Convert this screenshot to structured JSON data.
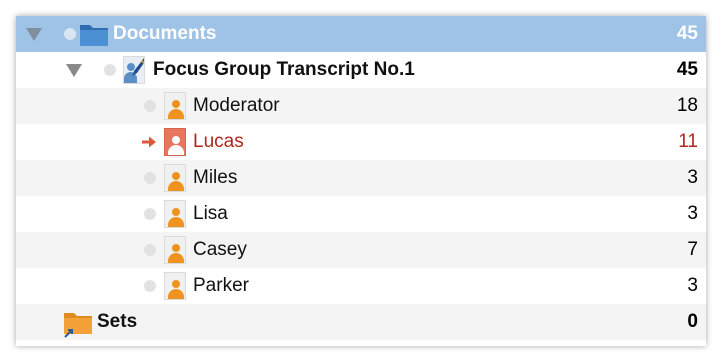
{
  "tree": {
    "root": {
      "label": "Documents",
      "count": "45"
    },
    "document": {
      "label": "Focus Group Transcript No.1",
      "count": "45"
    },
    "speakers": [
      {
        "label": "Moderator",
        "count": "18"
      },
      {
        "label": "Lucas",
        "count": "11"
      },
      {
        "label": "Miles",
        "count": "3"
      },
      {
        "label": "Lisa",
        "count": "3"
      },
      {
        "label": "Casey",
        "count": "7"
      },
      {
        "label": "Parker",
        "count": "3"
      }
    ],
    "sets": {
      "label": "Sets",
      "count": "0"
    }
  },
  "colors": {
    "selected_row_bg": "#9ec3e6",
    "stripe_bg": "#f4f4f4",
    "active_text": "#b0281c",
    "active_arrow": "#e0553e",
    "person_icon": "#f0921e",
    "folder_blue": "#4a90d2",
    "folder_orange": "#f4a13a"
  },
  "icons": {
    "root": "folder-icon",
    "document": "document-edit-icon",
    "speaker": "person-document-icon",
    "sets": "folder-shortcut-icon",
    "expand": "disclosure-triangle-icon",
    "active": "arrow-right-icon"
  }
}
